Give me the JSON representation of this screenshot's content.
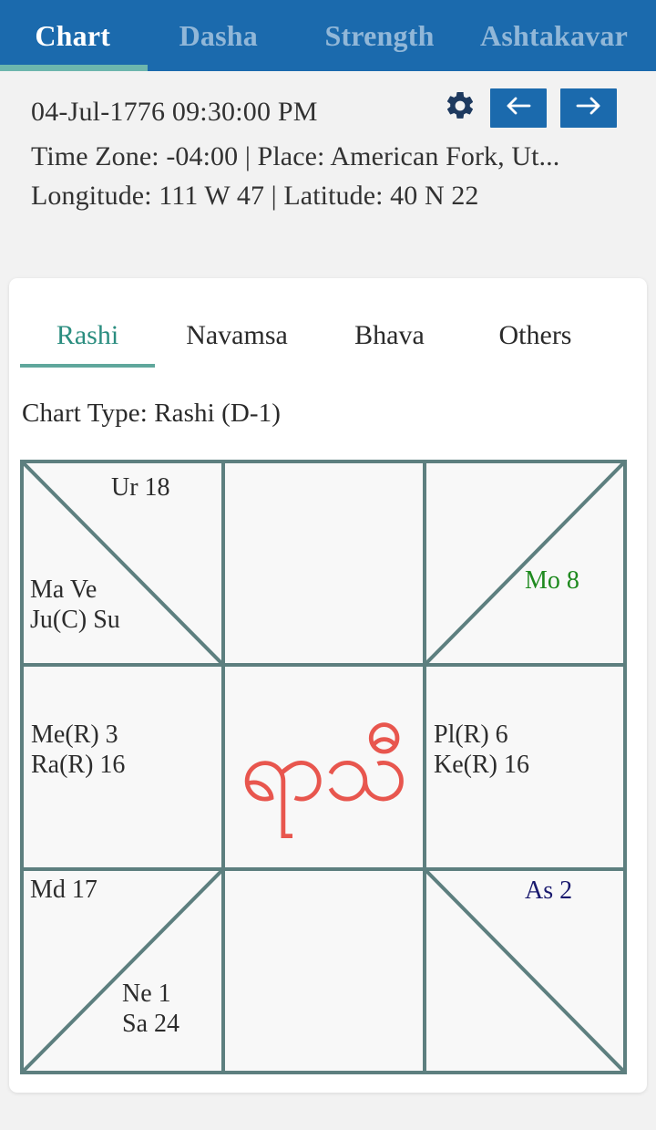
{
  "topbar": {
    "tabs": [
      {
        "label": "Chart",
        "active": true
      },
      {
        "label": "Dasha",
        "active": false
      },
      {
        "label": "Strength",
        "active": false
      },
      {
        "label": "Ashtakavar",
        "active": false
      }
    ],
    "accent_color": "#1b6aad",
    "underline_color": "#6db6ad"
  },
  "info": {
    "datetime": "04-Jul-1776 09:30:00 PM",
    "timezone_place": "Time Zone: -04:00 | Place: American Fork, Ut...",
    "coordinates": "Longitude: 111 W 47 | Latitude: 40 N 22",
    "gear_icon": "gear-icon",
    "prev_icon": "arrow-left-icon",
    "next_icon": "arrow-right-icon"
  },
  "card": {
    "subtabs": [
      {
        "label": "Rashi",
        "active": true
      },
      {
        "label": "Navamsa",
        "active": false
      },
      {
        "label": "Bhava",
        "active": false
      },
      {
        "label": "Others",
        "active": false
      }
    ],
    "chart_type": "Chart Type: Rashi (D-1)"
  },
  "chart_data": {
    "type": "table",
    "title": "Rashi (D-1)",
    "style": "south-indian-3x3-grid",
    "center_label": "ရာသီ",
    "center_color": "#e8564e",
    "grid_color": "#5d7f7f",
    "cells": [
      {
        "index": 0,
        "row": 0,
        "col": 0,
        "diagonal": "tl-br",
        "texts": [
          {
            "id": "ur",
            "value": "Ur 18",
            "color": "#2c2c2c"
          },
          {
            "id": "mave",
            "value": "Ma Ve\nJu(C) Su",
            "color": "#2c2c2c"
          }
        ]
      },
      {
        "index": 1,
        "row": 0,
        "col": 1,
        "diagonal": "none",
        "texts": []
      },
      {
        "index": 2,
        "row": 0,
        "col": 2,
        "diagonal": "bl-tr",
        "texts": [
          {
            "id": "mo",
            "value": "Mo 8",
            "color": "#1f8a1f"
          }
        ]
      },
      {
        "index": 3,
        "row": 1,
        "col": 0,
        "diagonal": "none",
        "texts": [
          {
            "id": "me",
            "value": "Me(R) 3\nRa(R) 16",
            "color": "#2c2c2c"
          }
        ]
      },
      {
        "index": 4,
        "row": 1,
        "col": 1,
        "diagonal": "none",
        "texts": []
      },
      {
        "index": 5,
        "row": 1,
        "col": 2,
        "diagonal": "none",
        "texts": [
          {
            "id": "pl",
            "value": "Pl(R) 6\nKe(R) 16",
            "color": "#2c2c2c"
          }
        ]
      },
      {
        "index": 6,
        "row": 2,
        "col": 0,
        "diagonal": "bl-tr",
        "texts": [
          {
            "id": "md",
            "value": "Md 17",
            "color": "#2c2c2c"
          },
          {
            "id": "nesa",
            "value": "Ne 1\nSa 24",
            "color": "#2c2c2c"
          }
        ]
      },
      {
        "index": 7,
        "row": 2,
        "col": 1,
        "diagonal": "none",
        "texts": []
      },
      {
        "index": 8,
        "row": 2,
        "col": 2,
        "diagonal": "tl-br",
        "texts": [
          {
            "id": "as",
            "value": "As 2",
            "color": "#1a1a6e"
          }
        ]
      }
    ],
    "planets": [
      {
        "abbr": "Ur",
        "name": "Uranus",
        "degree": 18
      },
      {
        "abbr": "Ma",
        "name": "Mars",
        "degree": null
      },
      {
        "abbr": "Ve",
        "name": "Venus",
        "degree": null
      },
      {
        "abbr": "Ju(C)",
        "name": "Jupiter",
        "degree": null
      },
      {
        "abbr": "Su",
        "name": "Sun",
        "degree": null
      },
      {
        "abbr": "Mo",
        "name": "Moon",
        "degree": 8
      },
      {
        "abbr": "Me(R)",
        "name": "Mercury",
        "degree": 3
      },
      {
        "abbr": "Ra(R)",
        "name": "Rahu",
        "degree": 16
      },
      {
        "abbr": "Pl(R)",
        "name": "Pluto",
        "degree": 6
      },
      {
        "abbr": "Ke(R)",
        "name": "Ketu",
        "degree": 16
      },
      {
        "abbr": "Md",
        "name": "Midheaven",
        "degree": 17
      },
      {
        "abbr": "Ne",
        "name": "Neptune",
        "degree": 1
      },
      {
        "abbr": "Sa",
        "name": "Saturn",
        "degree": 24
      },
      {
        "abbr": "As",
        "name": "Ascendant",
        "degree": 2
      }
    ]
  }
}
